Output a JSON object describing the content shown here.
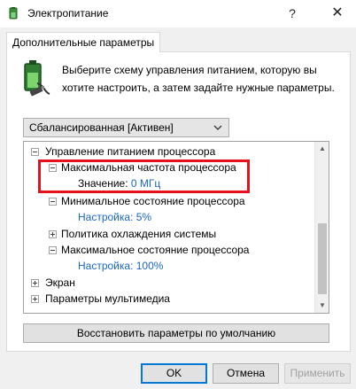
{
  "window": {
    "title": "Электропитание",
    "help_glyph": "?",
    "close_glyph": "✕"
  },
  "tab": {
    "label": "Дополнительные параметры"
  },
  "description": "Выберите схему управления питанием, которую вы хотите настроить, а затем задайте нужные параметры.",
  "scheme": {
    "selected": "Сбалансированная [Активен]"
  },
  "tree": {
    "processor_power": "Управление питанием процессора",
    "max_frequency": "Максимальная частота процессора",
    "max_frequency_value": "Значение: 0 МГц",
    "min_state": "Минимальное состояние процессора",
    "min_state_value": "Настройка: 5%",
    "cooling_policy": "Политика охлаждения системы",
    "max_state": "Максимальное состояние процессора",
    "max_state_value": "Настройка: 100%",
    "screen": "Экран",
    "multimedia": "Параметры мультимедиа"
  },
  "buttons": {
    "restore_defaults": "Восстановить параметры по умолчанию",
    "ok": "OK",
    "cancel": "Отмена",
    "apply": "Применить"
  },
  "colors": {
    "setting_value": "#1766c9",
    "highlight": "#e8101c",
    "default_button_border": "#0078d7"
  },
  "icons": {
    "app": "power-options-icon",
    "battery": "battery-plug-icon",
    "dropdown": "chevron-down-icon"
  }
}
